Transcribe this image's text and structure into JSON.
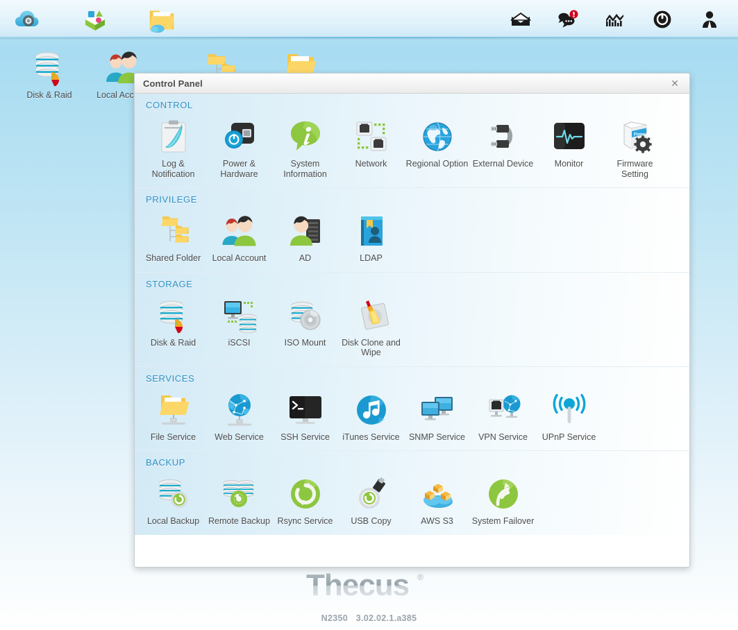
{
  "topbar": {
    "left_icons": [
      {
        "name": "cloud-backup-icon",
        "label": "Cloud Backup"
      },
      {
        "name": "app-center-icon",
        "label": "App Center"
      },
      {
        "name": "file-manager-icon",
        "label": "File Manager"
      }
    ],
    "right_icons": [
      {
        "name": "mail-icon",
        "label": "Mail"
      },
      {
        "name": "notification-chat-icon",
        "label": "Notifications",
        "badge": "!"
      },
      {
        "name": "monitor-graph-icon",
        "label": "Monitor"
      },
      {
        "name": "power-icon",
        "label": "Power"
      },
      {
        "name": "user-account-icon",
        "label": "User"
      }
    ]
  },
  "desktop": {
    "icons": [
      {
        "name": "desktop-icon-disk-raid",
        "label": "Disk & Raid",
        "icon": "disk-raid-icon"
      },
      {
        "name": "desktop-icon-local-account",
        "label": "Local Account",
        "icon": "local-account-icon"
      },
      {
        "name": "desktop-icon-shared-folder",
        "label": "Shared Folder",
        "icon": "shared-folder-icon"
      },
      {
        "name": "desktop-icon-file-service",
        "label": "File Service",
        "icon": "file-service-icon"
      }
    ]
  },
  "control_panel": {
    "title": "Control Panel",
    "close_label": "✕",
    "sections": [
      {
        "title": "CONTROL",
        "items": [
          {
            "label": "Log & Notification",
            "icon": "log-notification-icon"
          },
          {
            "label": "Power & Hardware",
            "icon": "power-hardware-icon"
          },
          {
            "label": "System Information",
            "icon": "system-information-icon"
          },
          {
            "label": "Network",
            "icon": "network-icon"
          },
          {
            "label": "Regional Option",
            "icon": "regional-option-icon"
          },
          {
            "label": "External Device",
            "icon": "external-device-icon"
          },
          {
            "label": "Monitor",
            "icon": "monitor-icon"
          },
          {
            "label": "Firmware Setting",
            "icon": "firmware-setting-icon"
          }
        ]
      },
      {
        "title": "PRIVILEGE",
        "items": [
          {
            "label": "Shared Folder",
            "icon": "shared-folder-icon"
          },
          {
            "label": "Local Account",
            "icon": "local-account-icon"
          },
          {
            "label": "AD",
            "icon": "ad-icon"
          },
          {
            "label": "LDAP",
            "icon": "ldap-icon"
          }
        ]
      },
      {
        "title": "STORAGE",
        "items": [
          {
            "label": "Disk & Raid",
            "icon": "disk-raid-icon"
          },
          {
            "label": "iSCSI",
            "icon": "iscsi-icon"
          },
          {
            "label": "ISO Mount",
            "icon": "iso-mount-icon"
          },
          {
            "label": "Disk Clone and Wipe",
            "icon": "disk-clone-wipe-icon"
          }
        ]
      },
      {
        "title": "SERVICES",
        "items": [
          {
            "label": "File Service",
            "icon": "file-service-icon"
          },
          {
            "label": "Web Service",
            "icon": "web-service-icon"
          },
          {
            "label": "SSH Service",
            "icon": "ssh-service-icon"
          },
          {
            "label": "iTunes Service",
            "icon": "itunes-service-icon"
          },
          {
            "label": "SNMP Service",
            "icon": "snmp-service-icon"
          },
          {
            "label": "VPN Service",
            "icon": "vpn-service-icon"
          },
          {
            "label": "UPnP Service",
            "icon": "upnp-service-icon"
          }
        ]
      },
      {
        "title": "BACKUP",
        "items": [
          {
            "label": "Local Backup",
            "icon": "local-backup-icon"
          },
          {
            "label": "Remote Backup",
            "icon": "remote-backup-icon"
          },
          {
            "label": "Rsync Service",
            "icon": "rsync-service-icon"
          },
          {
            "label": "USB Copy",
            "icon": "usb-copy-icon"
          },
          {
            "label": "AWS S3",
            "icon": "aws-s3-icon"
          },
          {
            "label": "System Failover",
            "icon": "system-failover-icon"
          }
        ]
      }
    ]
  },
  "footer": {
    "brand": "Thecus",
    "brand_mark": "®",
    "model": "N2350",
    "version": "3.02.02.1.a385"
  },
  "colors": {
    "accent": "#2e8fc4",
    "desktop_top": "#a8dcf2",
    "label": "#4d4d4d",
    "badge": "#d0021b"
  }
}
